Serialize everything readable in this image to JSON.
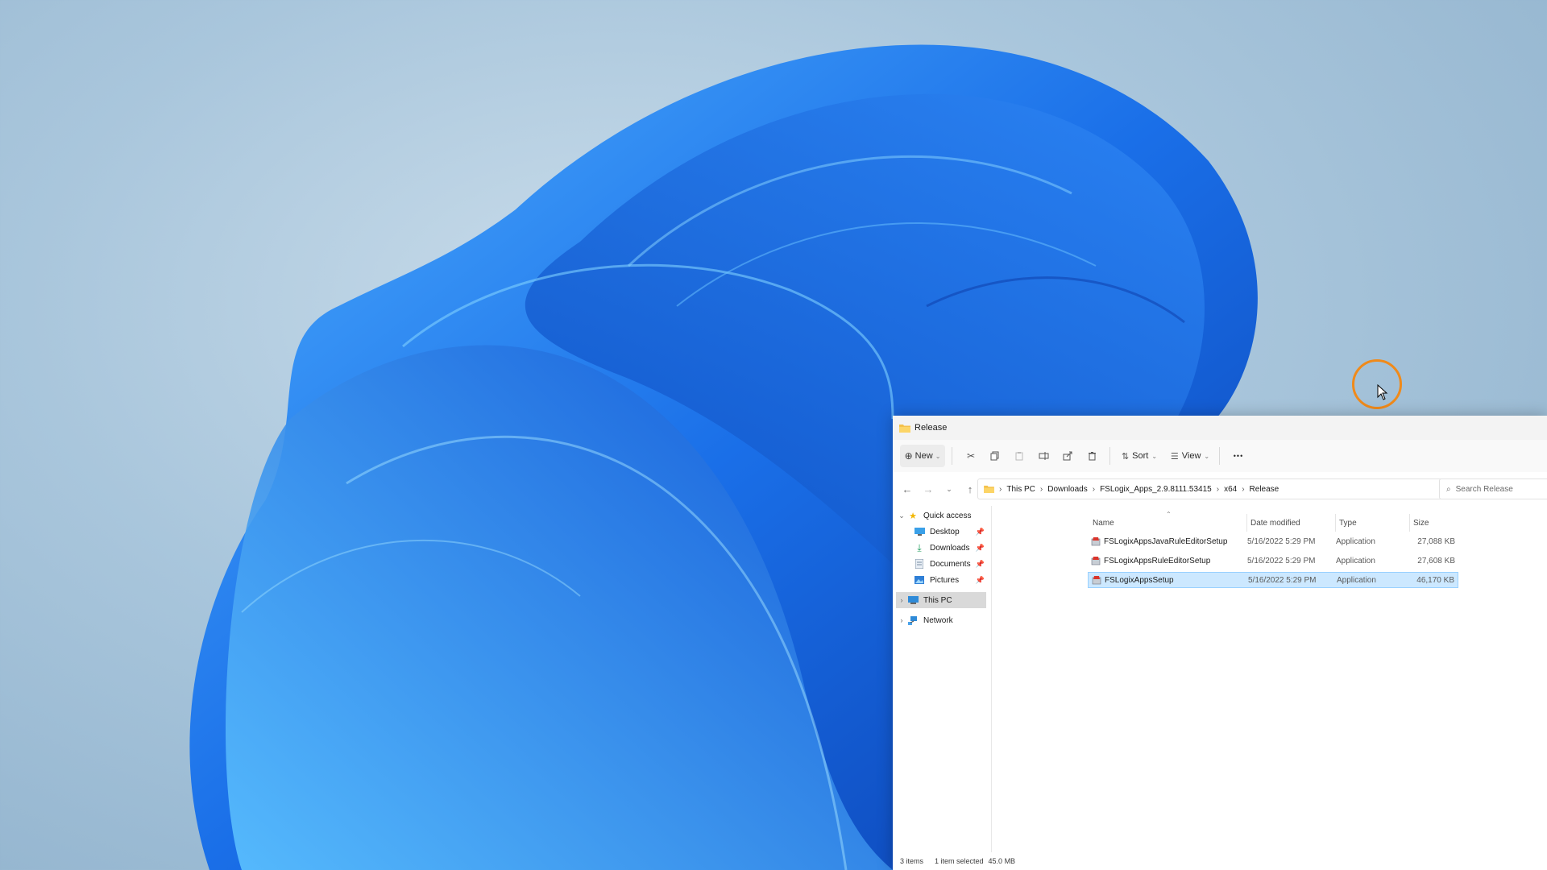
{
  "window": {
    "title": "Release"
  },
  "toolbar": {
    "new_label": "New",
    "sort_label": "Sort",
    "view_label": "View",
    "more_label": "•••"
  },
  "address": {
    "crumbs": [
      "This PC",
      "Downloads",
      "FSLogix_Apps_2.9.8111.53415",
      "x64",
      "Release"
    ],
    "search_placeholder": "Search Release"
  },
  "nav": {
    "quick_access": "Quick access",
    "desktop": "Desktop",
    "downloads": "Downloads",
    "documents": "Documents",
    "pictures": "Pictures",
    "this_pc": "This PC",
    "network": "Network"
  },
  "columns": {
    "name": "Name",
    "date": "Date modified",
    "type": "Type",
    "size": "Size"
  },
  "files": [
    {
      "name": "FSLogixAppsJavaRuleEditorSetup",
      "date": "5/16/2022 5:29 PM",
      "type": "Application",
      "size": "27,088 KB"
    },
    {
      "name": "FSLogixAppsRuleEditorSetup",
      "date": "5/16/2022 5:29 PM",
      "type": "Application",
      "size": "27,608 KB"
    },
    {
      "name": "FSLogixAppsSetup",
      "date": "5/16/2022 5:29 PM",
      "type": "Application",
      "size": "46,170 KB"
    }
  ],
  "status": {
    "items": "3 items",
    "selected": "1 item selected",
    "size": "45.0 MB"
  },
  "colors": {
    "accent_selection": "#cce8ff",
    "cursor_ring": "#f08a1a",
    "wallpaper_blue": "#1a6fe0"
  }
}
